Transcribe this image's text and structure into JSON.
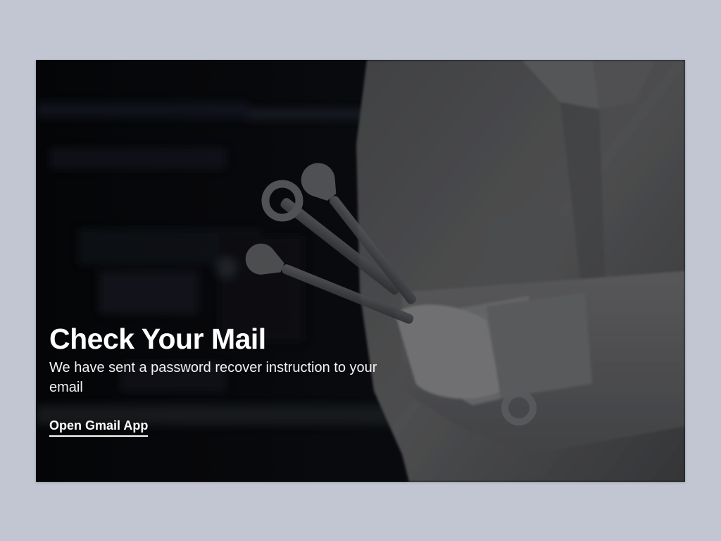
{
  "hero": {
    "image_icon": "mechanic-holding-wrenches-photo"
  },
  "content": {
    "title": "Check Your Mail",
    "subtitle": "We have sent a password recover instruction to your email",
    "link_label": "Open Gmail App"
  },
  "colors": {
    "page_background": "#c2c6d3",
    "card_background": "#0a0b0e",
    "text": "#ffffff"
  }
}
